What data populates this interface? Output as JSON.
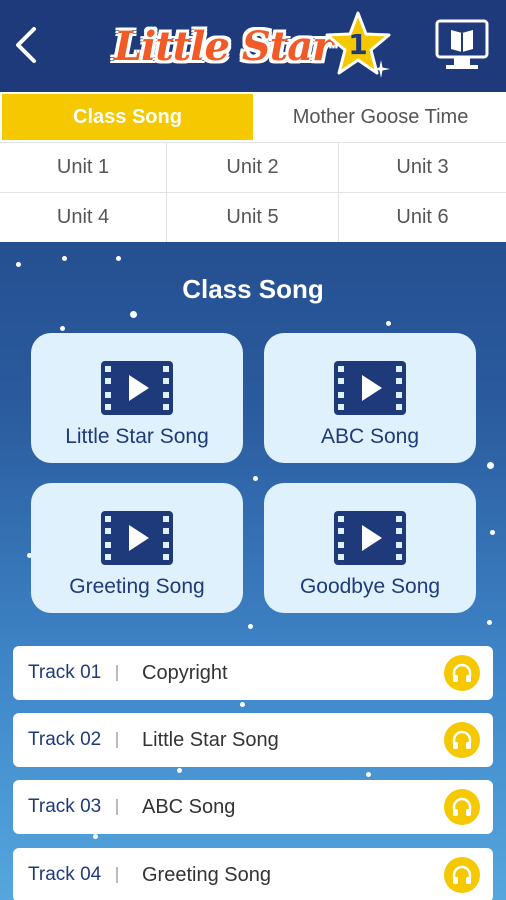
{
  "header": {
    "logo_text": "Little Star",
    "level_number": "1"
  },
  "tabs": [
    {
      "label": "Class Song",
      "active": true
    },
    {
      "label": "Mother Goose Time",
      "active": false
    }
  ],
  "units": [
    "Unit 1",
    "Unit 2",
    "Unit 3",
    "Unit 4",
    "Unit 5",
    "Unit 6"
  ],
  "section": {
    "title": "Class Song",
    "videos": [
      {
        "label": "Little Star Song"
      },
      {
        "label": "ABC Song"
      },
      {
        "label": "Greeting Song"
      },
      {
        "label": "Goodbye Song"
      }
    ]
  },
  "tracks": [
    {
      "number": "Track 01",
      "title": "Copyright"
    },
    {
      "number": "Track 02",
      "title": "Little Star Song"
    },
    {
      "number": "Track 03",
      "title": "ABC Song"
    },
    {
      "number": "Track 04",
      "title": "Greeting Song"
    }
  ],
  "colors": {
    "header_bg": "#1f3a7a",
    "accent_yellow": "#f5c800",
    "logo_orange": "#f25a28",
    "card_bg": "#dff1fc"
  }
}
